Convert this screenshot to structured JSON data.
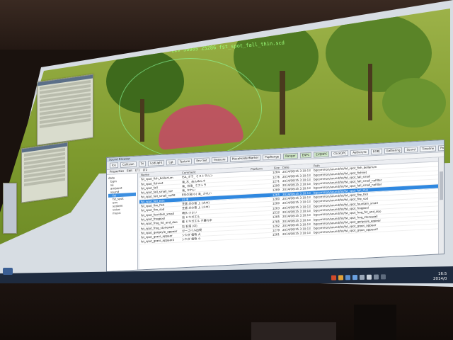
{
  "viewport": {
    "overlay_text": "LEV 30005 25286 fst_spot_fall_thin.scd"
  },
  "browser": {
    "title": "Sound Browser",
    "toolbar_buttons": [
      "Ice",
      "Collision",
      "Tri",
      "LodLight",
      "Lgt",
      "Texture",
      "Env Set",
      "Treasure",
      "PlaceHolderMarker",
      "PopRange",
      "Ranger",
      "ENPC",
      "EVENPC",
      "ClickOPC",
      "Aetheryte",
      "EOBJ",
      "Gathering",
      "Sound",
      "Timeline",
      "Path"
    ],
    "sub_tabs": [
      "Properties",
      "Edit",
      "LT1",
      "LT2"
    ],
    "tree_items": [
      "data",
      "bgm",
      "se",
      "ambient",
      "sound",
      "fst",
      "fst_spot",
      "env",
      "system",
      "voice",
      "music"
    ],
    "selected_tree_index": 5,
    "columns": [
      "Name",
      "Comment",
      "Platform",
      "Size",
      "Date",
      "Path"
    ],
    "rows": [
      [
        "fst_spot_fish_bollarium",
        "ISA_ボラ_ ミストラルン",
        "",
        "1284",
        "2014/08/15 3:10:13",
        "bgcommon/sound/fst/fst_spot_fish_bellarium"
      ],
      [
        "fst_spot_fishnet",
        "滝_木_ ぬんぬんネ",
        "",
        "1276",
        "2014/08/15 3:10:13",
        "bgcommon/sound/fst/fst_spot_fishnet"
      ],
      [
        "fst_spot_fall",
        "滝_ 谷滝_ ミストラ",
        "",
        "1271",
        "2014/08/15 3:10:13",
        "bgcommon/sound/fst/fst_spot_fall_small"
      ],
      [
        "fst_spot_fall_small_nof",
        "滝_ かれい",
        "",
        "1290",
        "2014/08/15 3:10:13",
        "bgcommon/sound/fst/fst_spot_fall_small_nofilter"
      ],
      [
        "fst_spot_fall_small_nofilt",
        "ESIの滝(小) 滝_ かれい",
        "",
        "1289",
        "2014/08/15 3:10:13",
        "bgcommon/sound/fst/fst_spot_fall_small_nofilter"
      ],
      [
        "fst_spot_fall_thin",
        "川 滝",
        "",
        "1265",
        "2014/08/15 3:10:13",
        "bgcommon/sound/fst/fst_spot_fall_thin"
      ],
      [
        "fst_spot_fire_fish",
        "芝居 炎の音 上 (大木)",
        "",
        "1280",
        "2014/08/15 3:10:13",
        "bgcommon/sound/fst/fst_spot_fire_fish"
      ],
      [
        "fst_spot_fire_sod",
        "芝居 炎の音 上 (小木)",
        "",
        "1280",
        "2014/08/15 3:10:13",
        "bgcommon/sound/fst/fst_spot_fire_sod"
      ],
      [
        "fst_spot_fountain_small",
        "噴水 小さい",
        "",
        "1283",
        "2014/08/15 3:10:13",
        "bgcommon/sound/fst/fst_spot_fountain_small"
      ],
      [
        "fst_spot_frogpool",
        "池 ヒキガエル",
        "",
        "1512",
        "2014/08/15 3:10:13",
        "bgcommon/sound/fst/fst_spot_frogpool"
      ],
      [
        "fst_spot_frog_fst_and_doo",
        "蛙 ヒキガエル 夕暮れ中",
        "",
        "1285",
        "2014/08/15 3:10:13",
        "bgcommon/sound/fst/fst_spot_frog_fst_and_doo"
      ],
      [
        "fst_spot_frog_stonewall",
        "石 石垣 (中)",
        "",
        "2785",
        "2014/08/15 3:10:13",
        "bgcommon/sound/fst/fst_spot_frog_stonewall"
      ],
      [
        "fst_spot_gargoyle_appear",
        "ガーゴイル出現",
        "",
        "1292",
        "2014/08/15 3:10:13",
        "bgcommon/sound/fst/fst_spot_gargoyle_appear"
      ],
      [
        "fst_spot_grass_appear",
        "シカダ 植物 大",
        "",
        "1279",
        "2014/08/15 3:10:13",
        "bgcommon/sound/fst/fst_spot_grass_appear"
      ],
      [
        "fst_spot_grass_appear2",
        "シカダ 植物 小",
        "",
        "1281",
        "2014/08/15 3:10:13",
        "bgcommon/sound/fst/fst_spot_grass_appear2"
      ]
    ],
    "selected_row_index": 5
  },
  "taskbar": {
    "clock_time": "16:5",
    "clock_date": "2014/0"
  }
}
